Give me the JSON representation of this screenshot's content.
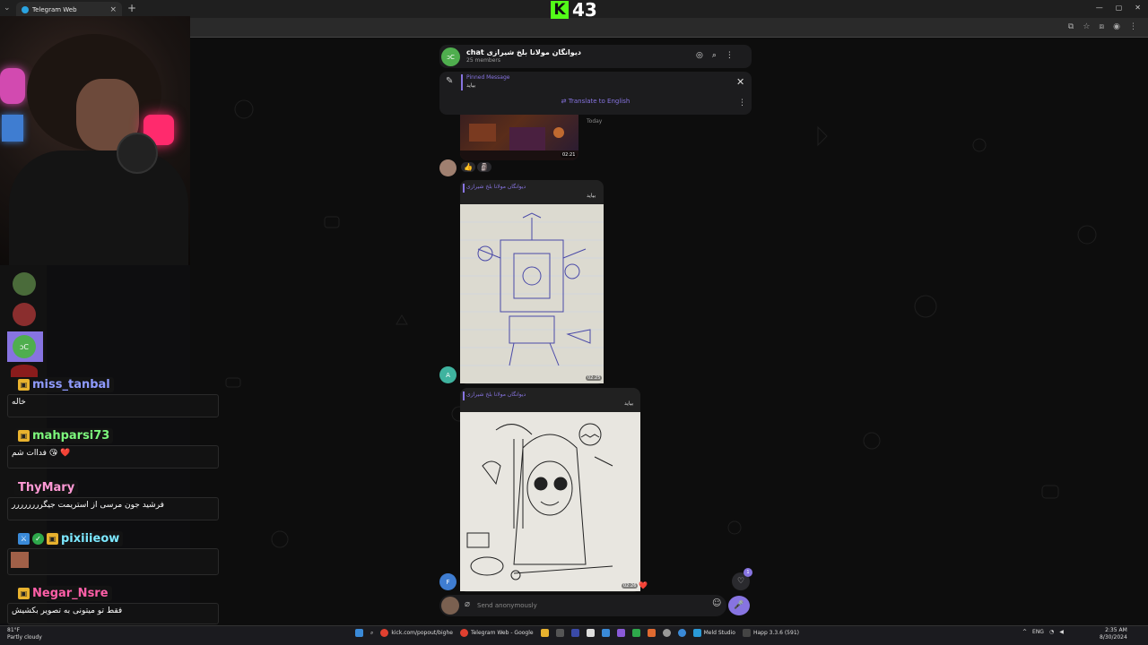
{
  "browser": {
    "tab_title": "Telegram Web",
    "tab_close": "×",
    "new_tab": "+"
  },
  "logo": {
    "letter": "K",
    "number": "43"
  },
  "chat": {
    "avatar_initials": "ɔC",
    "title": "chat دیوانگان مولانا بلخ شیرازی",
    "members": "25 members"
  },
  "pinned": {
    "label": "Pinned Message",
    "text": "بیاید",
    "translate": "Translate to English"
  },
  "messages": [
    {
      "time": "02:21",
      "divider": "Today",
      "reactions": [
        "👍",
        "🗿"
      ]
    },
    {
      "forward_from": "دیوانگان مولانا بلخ شیرازی",
      "caption": "بیاید",
      "time": "02:25",
      "sender_initial": "A",
      "sender_color": "#3fb39f"
    },
    {
      "forward_from": "دیوانگان مولانا بلخ شیرازی",
      "caption": "بیاید",
      "time": "02:26",
      "sender_initial": "F",
      "sender_color": "#3f7dd1",
      "reaction": "❤️"
    }
  ],
  "composer": {
    "placeholder": "Send anonymously",
    "unread_count": "1"
  },
  "stream_chat": [
    {
      "name": "miss_tanbal",
      "name_color": "#8f9bff",
      "text": "خاله"
    },
    {
      "name": "mahparsi73",
      "name_color": "#7cf77c",
      "text": "فداات شم 😘 ❤️"
    },
    {
      "name": "ThyMary",
      "name_color": "#ff9ad6",
      "text": "فرشید جون مرسی از استریمت جیگرررررررر"
    },
    {
      "name": "pixiiieow",
      "name_color": "#7ce8ff",
      "text": ""
    },
    {
      "name": "Negar_Nsre",
      "name_color": "#ff5fa8",
      "text": "فقط تو میتونی به تصویر بکشیش"
    }
  ],
  "taskbar": {
    "weather_temp": "81°F",
    "weather_desc": "Partly cloudy",
    "items": [
      "kick.com/popout/bighe",
      "Telegram Web - Google",
      "Meld Studio",
      "Happ 3.3.6 (591)"
    ],
    "lang": "ENG",
    "time": "2:35 AM",
    "date": "8/30/2024"
  },
  "colors": {
    "accent": "#8774e1",
    "kick_green": "#53fc18",
    "bubble": "#212121"
  }
}
